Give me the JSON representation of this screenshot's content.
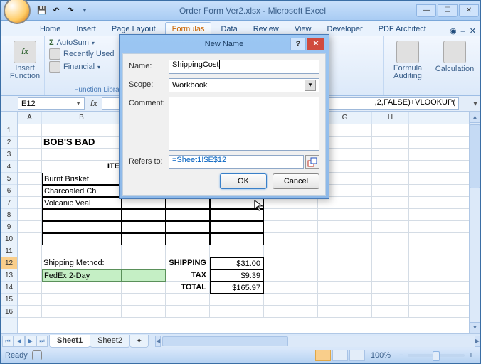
{
  "title": "Order Form Ver2.xlsx - Microsoft Excel",
  "tabs": [
    "Home",
    "Insert",
    "Page Layout",
    "Formulas",
    "Data",
    "Review",
    "View",
    "Developer",
    "PDF Architect"
  ],
  "active_tab": "Formulas",
  "ribbon": {
    "insert_function": "Insert Function",
    "autosum": "AutoSum",
    "recently_used": "Recently Used",
    "financial": "Financial",
    "function_library": "Function Library",
    "formula_auditing": "Formula Auditing",
    "calculation": "Calculation"
  },
  "namebox": "E12",
  "formula_fragment": ",2,FALSE)+VLOOKUP(",
  "cols": [
    "A",
    "B",
    "C",
    "D",
    "E",
    "F",
    "G",
    "H"
  ],
  "rows": [
    "1",
    "2",
    "3",
    "4",
    "5",
    "6",
    "7",
    "8",
    "9",
    "10",
    "11",
    "12",
    "13",
    "14",
    "15",
    "16"
  ],
  "sheet": {
    "title_text": "BOB'S BAD",
    "item_hdr": "ITE",
    "items": [
      "Burnt Brisket",
      "Charcoaled Ch",
      "Volcanic Veal"
    ],
    "shipping_method_label": "Shipping Method:",
    "shipping_method_value": "FedEx 2-Day",
    "summary": {
      "shipping_l": "SHIPPING",
      "shipping_v": "$31.00",
      "tax_l": "TAX",
      "tax_v": "$9.39",
      "total_l": "TOTAL",
      "total_v": "$165.97"
    }
  },
  "sheets": [
    "Sheet1",
    "Sheet2"
  ],
  "status": {
    "ready": "Ready",
    "zoom": "100%"
  },
  "dialog": {
    "title": "New Name",
    "name_l": "Name:",
    "name_v": "ShippingCost",
    "scope_l": "Scope:",
    "scope_v": "Workbook",
    "comment_l": "Comment:",
    "refers_l": "Refers to:",
    "refers_v": "=Sheet1!$E$12",
    "ok": "OK",
    "cancel": "Cancel"
  }
}
